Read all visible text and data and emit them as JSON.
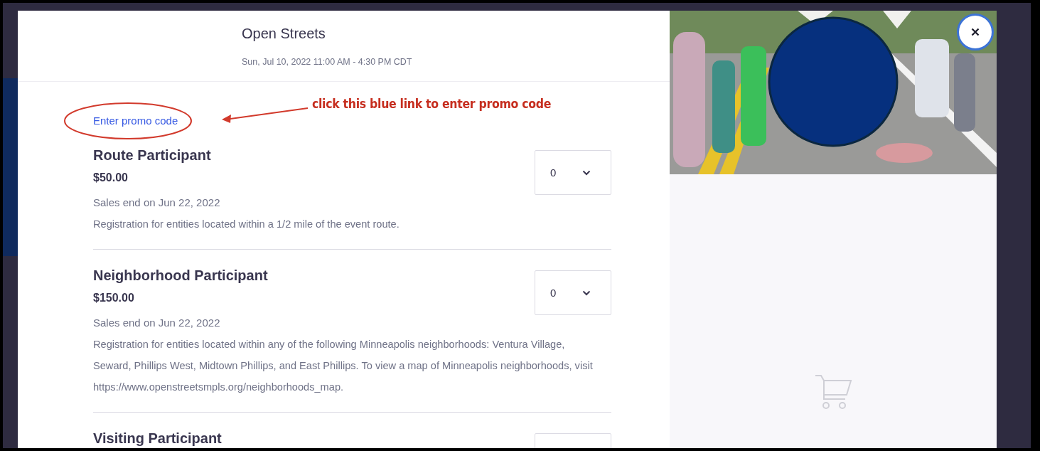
{
  "header": {
    "title": "Open Streets",
    "date": "Sun, Jul 10, 2022 11:00 AM - 4:30 PM CDT"
  },
  "promo_link": "Enter promo code",
  "annotation": {
    "note": "click this blue link to enter promo code"
  },
  "tickets": [
    {
      "name": "Route Participant",
      "price": "$50.00",
      "sales_end": "Sales end on Jun 22, 2022",
      "description": "Registration for entities located within a 1/2 mile of the event route.",
      "quantity": "0"
    },
    {
      "name": "Neighborhood Participant",
      "price": "$150.00",
      "sales_end": "Sales end on Jun 22, 2022",
      "description": "Registration for entities located within any of the following Minneapolis neighborhoods: Ventura Village, Seward, Phillips West, Midtown Phillips, and East Phillips. To view a map of Minneapolis neighborhoods, visit https://www.openstreetsmpls.org/neighborhoods_map.",
      "quantity": "0"
    },
    {
      "name": "Visiting Participant"
    }
  ]
}
